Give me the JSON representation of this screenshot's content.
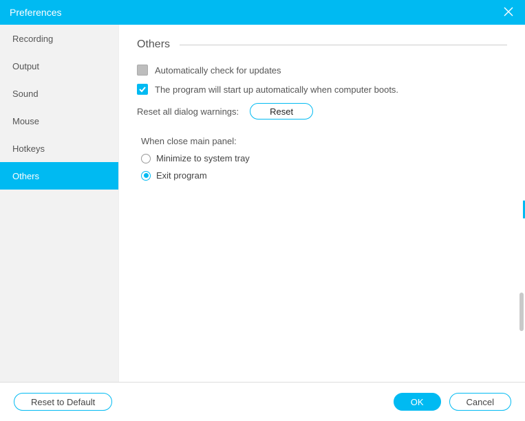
{
  "window": {
    "title": "Preferences"
  },
  "sidebar": {
    "items": [
      {
        "label": "Recording",
        "active": false
      },
      {
        "label": "Output",
        "active": false
      },
      {
        "label": "Sound",
        "active": false
      },
      {
        "label": "Mouse",
        "active": false
      },
      {
        "label": "Hotkeys",
        "active": false
      },
      {
        "label": "Others",
        "active": true
      }
    ]
  },
  "main": {
    "section_title": "Others",
    "check_updates": {
      "label": "Automatically check for updates",
      "checked": false
    },
    "autostart": {
      "label": "The program will start up automatically when computer boots.",
      "checked": true
    },
    "reset_warnings": {
      "label": "Reset all dialog warnings:",
      "button": "Reset"
    },
    "close_panel": {
      "title": "When close main panel:",
      "options": [
        {
          "label": "Minimize to system tray",
          "selected": false
        },
        {
          "label": "Exit program",
          "selected": true
        }
      ]
    }
  },
  "footer": {
    "reset_default": "Reset to Default",
    "ok": "OK",
    "cancel": "Cancel"
  }
}
